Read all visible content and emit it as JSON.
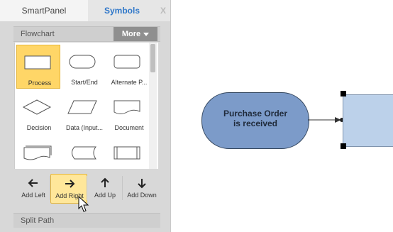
{
  "tabs": {
    "active": "SmartPanel",
    "inactive": "Symbols",
    "close": "X"
  },
  "flowchart": {
    "title": "Flowchart",
    "more_label": "More",
    "shapes": [
      {
        "label": "Process",
        "icon": "process-icon",
        "selected": true
      },
      {
        "label": "Start/End",
        "icon": "start-end-icon"
      },
      {
        "label": "Alternate P...",
        "icon": "alternate-process-icon"
      },
      {
        "label": "Decision",
        "icon": "decision-icon"
      },
      {
        "label": "Data (Input...",
        "icon": "data-icon"
      },
      {
        "label": "Document",
        "icon": "document-icon"
      }
    ]
  },
  "actions": [
    {
      "label": "Add Left",
      "icon": "arrow-left-icon"
    },
    {
      "label": "Add Right",
      "icon": "arrow-right-icon",
      "highlighted": true
    },
    {
      "label": "Add Up",
      "icon": "arrow-up-icon"
    },
    {
      "label": "Add Down",
      "icon": "arrow-down-icon"
    }
  ],
  "split_path": {
    "title": "Split Path"
  },
  "canvas": {
    "node_text_line1": "Purchase Order",
    "node_text_line2": "is received"
  },
  "colors": {
    "node_fill": "#7c9bc9",
    "rect_fill": "#bcd1ea",
    "selected_shape": "#ffd667",
    "symbols_tab": "#2f77c9"
  }
}
